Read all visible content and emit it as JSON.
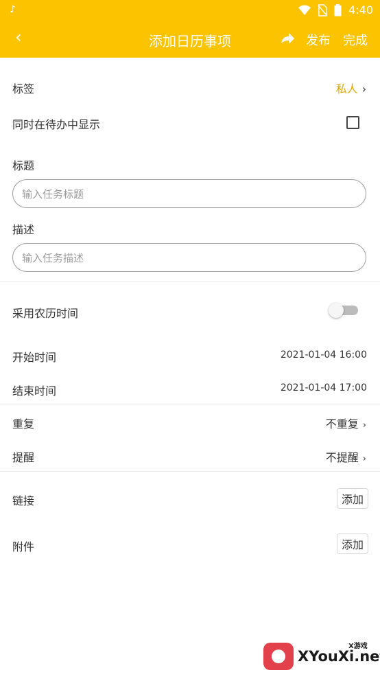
{
  "status_bar": {
    "left_icon": "tiktok-icon",
    "time": "4:40",
    "icons": [
      "wifi-icon",
      "no-sim-icon",
      "battery-icon"
    ]
  },
  "app_bar": {
    "back_icon": "chevron-left-icon",
    "title": "添加日历事项",
    "share_icon": "share-arrow-icon",
    "publish": "发布",
    "done": "完成"
  },
  "form": {
    "tag": {
      "label": "标签",
      "value": "私人"
    },
    "show_in_todo": {
      "label": "同时在待办中显示",
      "checked": false
    },
    "title_field": {
      "label": "标题",
      "placeholder": "输入任务标题"
    },
    "desc_field": {
      "label": "描述",
      "placeholder": "输入任务描述"
    },
    "lunar": {
      "label": "采用农历时间",
      "enabled": false
    },
    "start": {
      "label": "开始时间",
      "value": "2021-01-04 16:00"
    },
    "end": {
      "label": "结束时间",
      "value": "2021-01-04 17:00"
    },
    "repeat": {
      "label": "重复",
      "value": "不重复"
    },
    "reminder": {
      "label": "提醒",
      "value": "不提醒"
    },
    "link": {
      "label": "链接",
      "button": "添加"
    },
    "attachment": {
      "label": "附件",
      "button": "添加"
    }
  },
  "watermark": {
    "small": "X游戏",
    "main": "XYouXi.net"
  },
  "colors": {
    "accent": "#fcc300",
    "tag_value": "#e4a700"
  }
}
